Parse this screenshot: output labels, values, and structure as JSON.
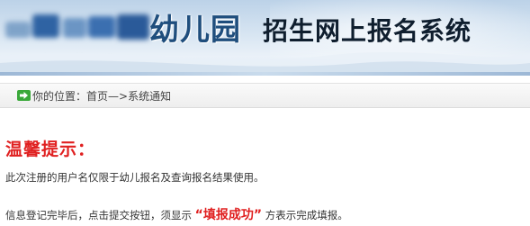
{
  "header": {
    "school_name_suffix": "幼儿园",
    "system_title": "招生网上报名系统"
  },
  "breadcrumb": {
    "prefix": "你的位置：",
    "home": "首页",
    "separator": "—>",
    "current": "系统通知"
  },
  "notice": {
    "title": "温馨提示：",
    "line1": "此次注册的用户名仅限于幼儿报名及查询报名结果使用。",
    "line2_before": "信息登记完毕后，点击提交按钮，须显示",
    "line2_highlight": "“填报成功”",
    "line2_after": "方表示完成填报。"
  },
  "colors": {
    "accent_red": "#e02020",
    "title_blue": "#1f4e7d",
    "icon_green": "#3aa83a"
  },
  "icons": {
    "breadcrumb_icon": "arrow-right-icon"
  }
}
